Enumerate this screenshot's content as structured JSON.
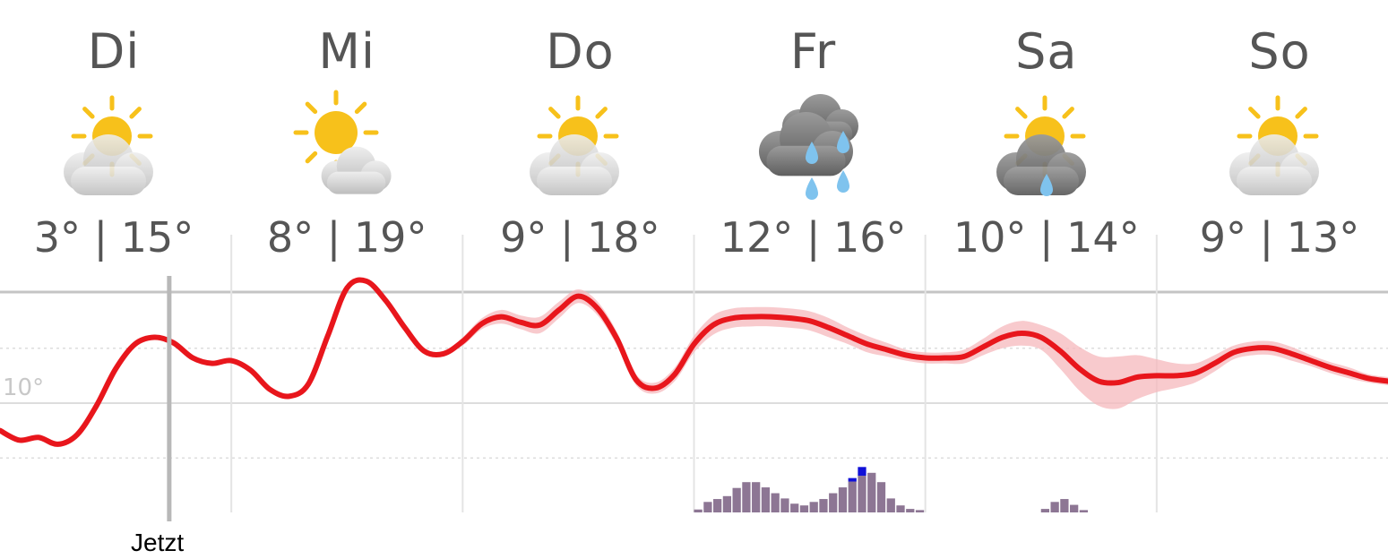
{
  "forecast": {
    "days": [
      {
        "name": "Di",
        "temp": "3° | 15°",
        "icon": "sun-cloud-icon"
      },
      {
        "name": "Mi",
        "temp": "8° | 19°",
        "icon": "sun-small-cloud-icon"
      },
      {
        "name": "Do",
        "temp": "9° | 18°",
        "icon": "sun-cloud-icon"
      },
      {
        "name": "Fr",
        "temp": "12° | 16°",
        "icon": "rain-cloud-icon"
      },
      {
        "name": "Sa",
        "temp": "10° | 14°",
        "icon": "sun-dark-cloud-rain-icon"
      },
      {
        "name": "So",
        "temp": "9° | 13°",
        "icon": "sun-cloud-icon"
      }
    ]
  },
  "chart": {
    "y_label": "10°",
    "now_label": "Jetzt"
  },
  "colors": {
    "temp_line": "#e8161c",
    "temp_band": "#f6b8bc",
    "precip": "#8d7694",
    "precip_heavy": "#1010d8"
  },
  "chart_data": {
    "type": "line",
    "ylim": [
      4,
      20
    ],
    "temperature_hours": [
      0,
      2,
      4,
      6,
      8,
      10,
      12,
      14,
      16,
      18,
      20,
      22,
      24,
      26,
      28,
      30,
      32,
      34,
      36,
      38,
      40,
      42,
      44,
      46,
      48,
      50,
      52,
      54,
      56,
      58,
      60,
      62,
      64,
      66,
      68,
      70,
      72,
      74,
      76,
      78,
      80,
      82,
      84,
      86,
      88,
      90,
      92,
      94,
      96,
      98,
      100,
      102,
      104,
      106,
      108,
      110,
      112,
      114,
      116,
      118,
      120,
      122,
      124,
      126,
      128,
      130,
      132,
      134,
      136,
      138,
      140,
      142,
      144
    ],
    "temperature": [
      8,
      7.3,
      7.5,
      7,
      7.7,
      9.8,
      12.5,
      14.3,
      14.8,
      14.4,
      13.3,
      12.9,
      13.1,
      12.4,
      11,
      10.5,
      11.4,
      14.9,
      18.4,
      18.9,
      17.5,
      15.5,
      13.8,
      13.6,
      14.5,
      15.8,
      16.3,
      15.9,
      15.7,
      16.8,
      17.8,
      16.9,
      14.7,
      11.7,
      11.1,
      12.1,
      14.3,
      15.7,
      16.2,
      16.3,
      16.3,
      16.2,
      16,
      15.5,
      14.9,
      14.3,
      13.9,
      13.5,
      13.3,
      13.3,
      13.4,
      14.1,
      14.8,
      15.1,
      14.8,
      13.8,
      12.5,
      11.6,
      11.5,
      11.9,
      12,
      12,
      12.2,
      12.9,
      13.7,
      14,
      14,
      13.6,
      13.1,
      12.6,
      12.2,
      11.8,
      11.6
    ],
    "temperature_band": [
      0,
      0,
      0,
      0,
      0,
      0,
      0,
      0,
      0,
      0,
      0,
      0,
      0,
      0,
      0,
      0,
      0,
      0,
      0,
      0,
      0,
      0,
      0,
      0,
      0.3,
      0.4,
      0.5,
      0.5,
      0.6,
      0.6,
      0.5,
      0.5,
      0.5,
      0.4,
      0.4,
      0.5,
      0.6,
      0.7,
      0.7,
      0.7,
      0.7,
      0.7,
      0.7,
      0.7,
      0.6,
      0.6,
      0.5,
      0.4,
      0.4,
      0.4,
      0.5,
      0.6,
      0.8,
      0.9,
      0.9,
      1.3,
      1.6,
      1.8,
      1.9,
      1.6,
      1.2,
      0.9,
      0.7,
      0.6,
      0.5,
      0.5,
      0.5,
      0.5,
      0.4,
      0.4,
      0.4,
      0.3,
      0.3
    ],
    "precip_start_hour": 72,
    "precipitation": [
      0.5,
      1.8,
      2.3,
      2.8,
      4.2,
      5.2,
      5.2,
      4.3,
      3.3,
      2.4,
      1.5,
      1.2,
      1.8,
      2.3,
      3.3,
      4.3,
      5.3,
      6.3,
      6.8,
      5.2,
      2.4,
      1.2,
      0.6,
      0.4,
      0,
      0,
      0,
      0,
      0,
      0,
      0,
      0,
      0,
      0,
      0,
      0,
      0.6,
      1.8,
      2.3,
      1.3,
      0.4
    ],
    "precip_heavy": [
      0,
      0,
      0,
      0,
      0,
      0,
      0,
      0,
      0,
      0,
      0,
      0,
      0,
      0,
      0,
      0,
      0.6,
      1.5,
      0,
      0,
      0,
      0,
      0,
      0,
      0,
      0,
      0,
      0,
      0,
      0,
      0,
      0,
      0,
      0,
      0,
      0,
      0,
      0,
      0,
      0,
      0
    ],
    "now_hour": 17
  }
}
